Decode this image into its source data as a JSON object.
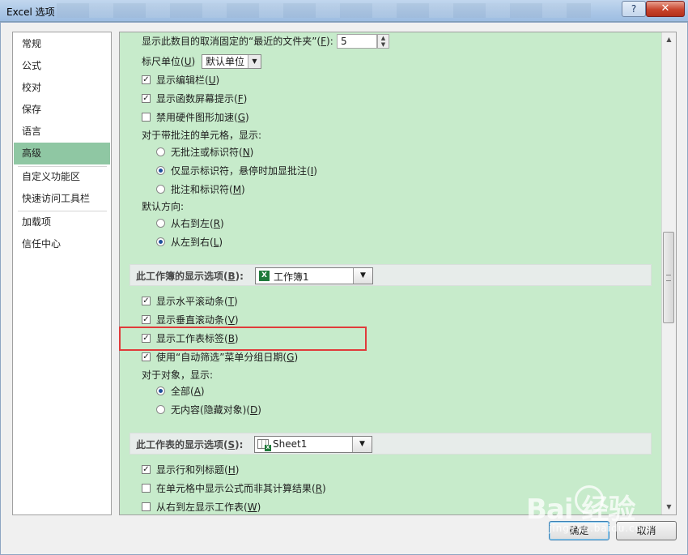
{
  "window": {
    "title": "Excel 选项",
    "help_label": "?",
    "close_label": "✕"
  },
  "nav": {
    "items": [
      {
        "label": "常规"
      },
      {
        "label": "公式"
      },
      {
        "label": "校对"
      },
      {
        "label": "保存"
      },
      {
        "label": "语言"
      },
      {
        "label": "高级",
        "active": true
      },
      {
        "label": "自定义功能区"
      },
      {
        "label": "快速访问工具栏"
      },
      {
        "label": "加载项"
      },
      {
        "label": "信任中心"
      }
    ]
  },
  "content": {
    "recent_folders": {
      "label_pre": "显示此数目的取消固定的“最近的文件夹”(",
      "key": "F",
      "label_post": "):",
      "value": "5"
    },
    "ruler": {
      "label_pre": "标尺单位(",
      "key": "U",
      "label_post": ")",
      "value": "默认单位"
    },
    "show_formula_bar": {
      "label_pre": "显示编辑栏(",
      "key": "U",
      "label_post": ")",
      "checked": true
    },
    "show_function_tips": {
      "label_pre": "显示函数屏幕提示(",
      "key": "F",
      "label_post": ")",
      "checked": true
    },
    "disable_hw_accel": {
      "label_pre": "禁用硬件图形加速(",
      "key": "G",
      "label_post": ")",
      "checked": false
    },
    "comments_heading": "对于带批注的单元格，显示:",
    "comments_options": [
      {
        "label_pre": "无批注或标识符(",
        "key": "N",
        "label_post": ")",
        "selected": false
      },
      {
        "label_pre": "仅显示标识符，悬停时加显批注(",
        "key": "I",
        "label_post": ")",
        "selected": true
      },
      {
        "label_pre": "批注和标识符(",
        "key": "M",
        "label_post": ")",
        "selected": false
      }
    ],
    "direction_heading": "默认方向:",
    "direction_options": [
      {
        "label_pre": "从右到左(",
        "key": "R",
        "label_post": ")",
        "selected": false
      },
      {
        "label_pre": "从左到右(",
        "key": "L",
        "label_post": ")",
        "selected": true
      }
    ],
    "workbook_section": {
      "label_pre": "此工作簿的显示选项(",
      "key": "B",
      "label_post": "):",
      "value": "工作簿1"
    },
    "show_hscroll": {
      "label_pre": "显示水平滚动条(",
      "key": "T",
      "label_post": ")",
      "checked": true
    },
    "show_vscroll": {
      "label_pre": "显示垂直滚动条(",
      "key": "V",
      "label_post": ")",
      "checked": true
    },
    "show_sheet_tabs": {
      "label_pre": "显示工作表标签(",
      "key": "B",
      "label_post": ")",
      "checked": true
    },
    "group_dates": {
      "label_pre": "使用“自动筛选”菜单分组日期(",
      "key": "G",
      "label_post": ")",
      "checked": true
    },
    "objects_heading": "对于对象，显示:",
    "objects_options": [
      {
        "label_pre": "全部(",
        "key": "A",
        "label_post": ")",
        "selected": true
      },
      {
        "label_pre": "无内容(隐藏对象)(",
        "key": "D",
        "label_post": ")",
        "selected": false
      }
    ],
    "worksheet_section": {
      "label_pre": "此工作表的显示选项(",
      "key": "S",
      "label_post": "):",
      "value": "Sheet1"
    },
    "show_row_col_headers": {
      "label_pre": "显示行和列标题(",
      "key": "H",
      "label_post": ")",
      "checked": true
    },
    "show_formulas": {
      "label_pre": "在单元格中显示公式而非其计算结果(",
      "key": "R",
      "label_post": ")",
      "checked": false
    },
    "rtl_sheet": {
      "label_pre": "从右到左显示工作表(",
      "key": "W",
      "label_post": ")",
      "checked": false
    }
  },
  "buttons": {
    "ok": "确定",
    "cancel": "取消"
  },
  "watermark": {
    "text": "Bai  经验",
    "sub": "jingyan.baidu.com"
  },
  "colors": {
    "content_bg": "#c7ebcb",
    "nav_active": "#8fc7a3",
    "highlight": "#e03b3b"
  }
}
